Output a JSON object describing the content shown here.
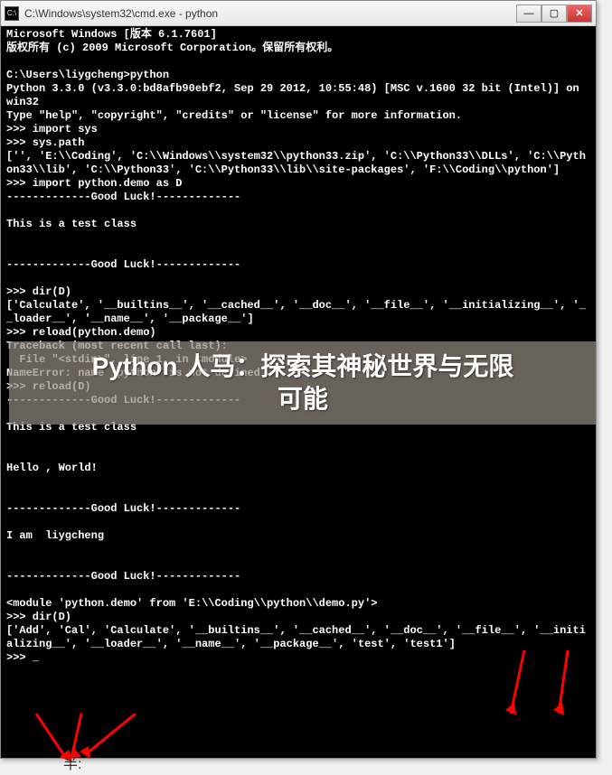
{
  "window": {
    "title": "C:\\Windows\\system32\\cmd.exe - python",
    "min": "—",
    "restore": "▢",
    "close": "✕"
  },
  "terminal_lines": [
    "Microsoft Windows [版本 6.1.7601]",
    "版权所有 (c) 2009 Microsoft Corporation。保留所有权利。",
    "",
    "C:\\Users\\liygcheng>python",
    "Python 3.3.0 (v3.3.0:bd8afb90ebf2, Sep 29 2012, 10:55:48) [MSC v.1600 32 bit (Intel)] on win32",
    "Type \"help\", \"copyright\", \"credits\" or \"license\" for more information.",
    ">>> import sys",
    ">>> sys.path",
    "['', 'E:\\\\Coding', 'C:\\\\Windows\\\\system32\\\\python33.zip', 'C:\\\\Python33\\\\DLLs', 'C:\\\\Python33\\\\lib', 'C:\\\\Python33', 'C:\\\\Python33\\\\lib\\\\site-packages', 'F:\\\\Coding\\\\python']",
    ">>> import python.demo as D",
    "-------------Good Luck!-------------",
    "",
    "This is a test class",
    "",
    "",
    "-------------Good Luck!-------------",
    "",
    ">>> dir(D)",
    "['Calculate', '__builtins__', '__cached__', '__doc__', '__file__', '__initializing__', '__loader__', '__name__', '__package__']",
    ">>> reload(python.demo)",
    "Traceback (most recent call last):",
    "  File \"<stdin>\", line 1, in <module>",
    "NameError: name 'python' is not defined",
    ">>> reload(D)",
    "-------------Good Luck!-------------",
    "",
    "This is a test class",
    "",
    "",
    "Hello , World!",
    "",
    "",
    "-------------Good Luck!-------------",
    "",
    "I am  liygcheng",
    "",
    "",
    "-------------Good Luck!-------------",
    "",
    "<module 'python.demo' from 'E:\\\\Coding\\\\python\\\\demo.py'>",
    ">>> dir(D)",
    "['Add', 'Cal', 'Calculate', '__builtins__', '__cached__', '__doc__', '__file__', '__initializing__', '__loader__', '__name__', '__package__', 'test', 'test1']",
    ">>> _"
  ],
  "overlay": {
    "line1": "Python 人马：探索其神秘世界与无限",
    "line2": "可能"
  },
  "caption": "半:"
}
